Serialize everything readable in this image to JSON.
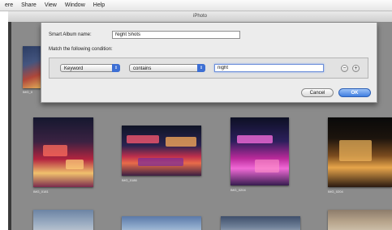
{
  "menubar": {
    "items": [
      "ere",
      "Share",
      "View",
      "Window",
      "Help"
    ]
  },
  "window": {
    "title": "iPhoto"
  },
  "dialog": {
    "album_name_label": "Smart Album name:",
    "album_name_value": "Night Shots",
    "match_label": "Match the following condition:",
    "condition": {
      "field": "Keyword",
      "operator": "contains",
      "value": "night"
    },
    "remove_label": "−",
    "add_label": "+",
    "cancel_label": "Cancel",
    "ok_label": "OK"
  },
  "photos": {
    "row1": [
      {
        "caption": "IMG_0"
      },
      {
        "caption": "IMG_0181"
      },
      {
        "caption": "IMG_0186"
      },
      {
        "caption": "IMG_0204"
      },
      {
        "caption": "IMG_0204"
      }
    ]
  },
  "colors": {
    "browser_background": "#8b8b8b",
    "dialog_background": "#ececec",
    "default_button": "#3f7ee0"
  }
}
